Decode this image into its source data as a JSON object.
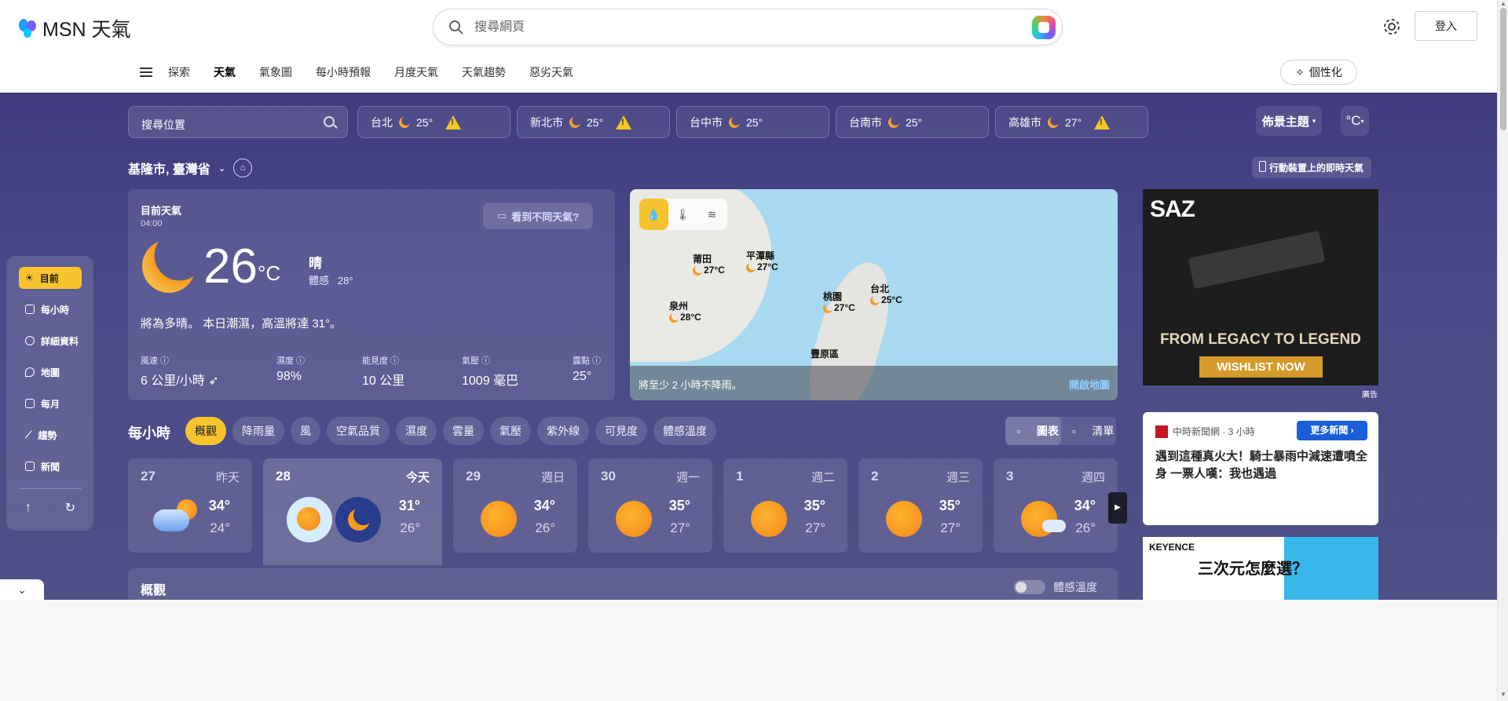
{
  "header": {
    "brand": "MSN 天氣",
    "search_placeholder": "搜尋網頁",
    "signin_label": "登入"
  },
  "nav": {
    "items": [
      "探索",
      "天氣",
      "氣象圖",
      "每小時預報",
      "月度天氣",
      "天氣趨勢",
      "惡劣天氣"
    ],
    "active": "天氣",
    "personalize_label": "個性化"
  },
  "location_bar": {
    "search_placeholder": "搜尋位置",
    "cities": [
      {
        "name": "台北",
        "temp": "25°",
        "warning": true
      },
      {
        "name": "新北市",
        "temp": "25°",
        "warning": true
      },
      {
        "name": "台中市",
        "temp": "25°",
        "warning": false
      },
      {
        "name": "台南市",
        "temp": "25°",
        "warning": false
      },
      {
        "name": "高雄市",
        "temp": "27°",
        "warning": true
      }
    ],
    "theme_label": "佈景主題",
    "unit_label": "°C"
  },
  "location": {
    "name": "基隆市, 臺灣省",
    "mobile_link": "行動裝置上的即時天氣"
  },
  "sidebar": {
    "items": [
      "目前",
      "每小時",
      "詳細資料",
      "地圖",
      "每月",
      "趨勢",
      "新聞"
    ],
    "active": "目前"
  },
  "current": {
    "title": "目前天氣",
    "time": "04:00",
    "different_weather": "看到不同天氣?",
    "temperature": "26",
    "unit": "°C",
    "condition": "晴",
    "feels_like_label": "體感",
    "feels_like": "28°",
    "summary": "將為多晴。 本日潮濕，高溫將達 31°。",
    "stats": [
      {
        "label": "風速",
        "value": "6 公里/小時"
      },
      {
        "label": "濕度",
        "value": "98%"
      },
      {
        "label": "能見度",
        "value": "10 公里"
      },
      {
        "label": "氣壓",
        "value": "1009 毫巴"
      },
      {
        "label": "露點",
        "value": "25°"
      }
    ]
  },
  "map": {
    "markers": [
      {
        "name": "莆田",
        "temp": "27°C"
      },
      {
        "name": "平潭縣",
        "temp": "27°C"
      },
      {
        "name": "泉州",
        "temp": "28°C"
      },
      {
        "name": "桃園",
        "temp": "27°C"
      },
      {
        "name": "台北",
        "temp": "25°C"
      },
      {
        "name": "豐原區",
        "temp": ""
      }
    ],
    "caption": "將至少 2 小時不降雨。",
    "open_label": "開啟地圖"
  },
  "ads": {
    "ad1": {
      "brand": "SAZ",
      "headline": "FROM LEGACY TO LEGEND",
      "cta": "WISHLIST NOW",
      "label": "廣告"
    },
    "news": {
      "source": "中時新聞網 · 3 小時",
      "more_label": "更多新聞",
      "title": "遇到這種真火大！騎士暴雨中減速遭噴全身 一票人嘆：我也遇過"
    },
    "ad2": {
      "brand": "KEYENCE",
      "headline": "三次元怎麼選？"
    }
  },
  "hourly": {
    "title": "每小時",
    "pills": [
      "概觀",
      "降雨量",
      "風",
      "空氣品質",
      "濕度",
      "雲量",
      "氣壓",
      "紫外線",
      "可見度",
      "體感溫度"
    ],
    "active_pill": "概觀",
    "view_chart": "圖表",
    "view_list": "清單"
  },
  "days": [
    {
      "date": "27",
      "weekday": "昨天",
      "high": "34°",
      "low": "24°",
      "icon": "rain-icon"
    },
    {
      "date": "28",
      "weekday": "今天",
      "high": "31°",
      "low": "26°",
      "icon": "day-night-icon"
    },
    {
      "date": "29",
      "weekday": "週日",
      "high": "34°",
      "low": "26°",
      "icon": "sun-icon"
    },
    {
      "date": "30",
      "weekday": "週一",
      "high": "35°",
      "low": "27°",
      "icon": "sun-icon"
    },
    {
      "date": "1",
      "weekday": "週二",
      "high": "35°",
      "low": "27°",
      "icon": "sun-icon"
    },
    {
      "date": "2",
      "weekday": "週三",
      "high": "35°",
      "low": "27°",
      "icon": "sun-icon"
    },
    {
      "date": "3",
      "weekday": "週四",
      "high": "34°",
      "low": "26°",
      "icon": "partly-cloudy-icon"
    }
  ],
  "overview": {
    "title": "概觀",
    "toggle_label": "體感溫度"
  },
  "colors": {
    "accent": "#f7c32e",
    "background_top": "#3f3b7e",
    "link": "#8fd0ff"
  }
}
